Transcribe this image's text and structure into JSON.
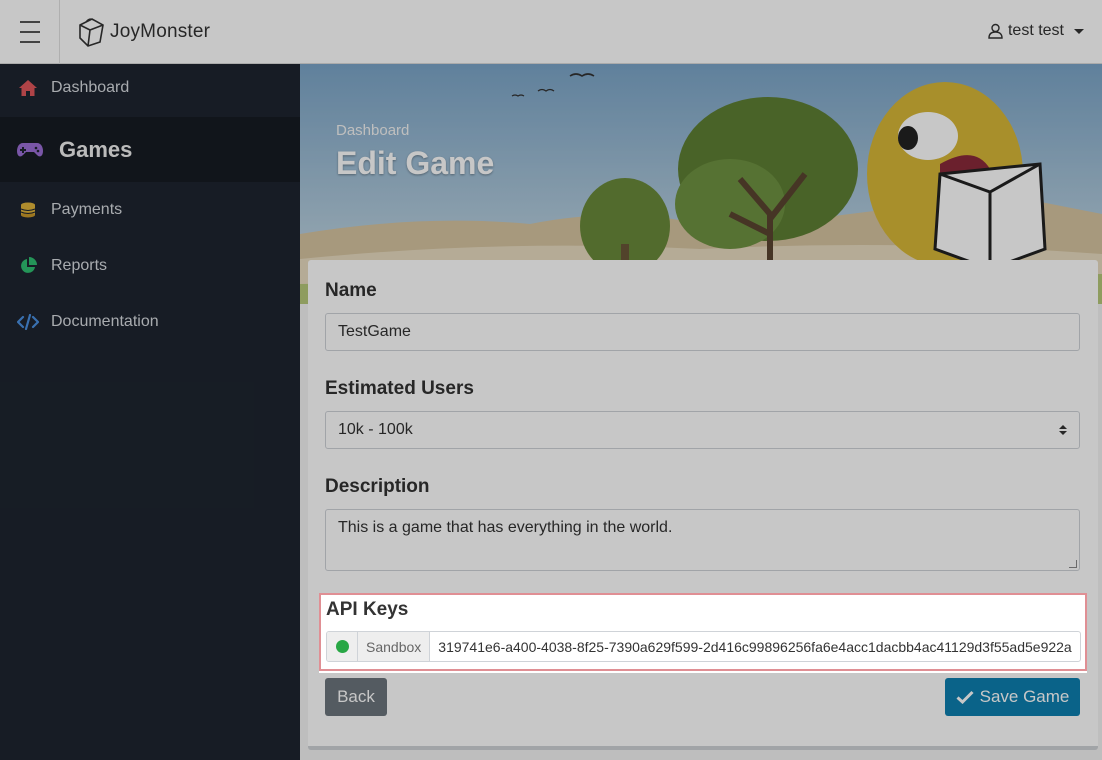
{
  "app": {
    "name": "JoyMonster"
  },
  "user": {
    "name": "test test"
  },
  "sidebar": {
    "items": [
      {
        "label": "Dashboard",
        "icon": "home-icon",
        "color": "#e0565b"
      },
      {
        "label": "Games",
        "icon": "gamepad-icon",
        "color": "#9b6fd6",
        "active": true
      },
      {
        "label": "Payments",
        "icon": "coins-icon",
        "color": "#e0b43a"
      },
      {
        "label": "Reports",
        "icon": "pie-chart-icon",
        "color": "#2fbf71"
      },
      {
        "label": "Documentation",
        "icon": "code-icon",
        "color": "#4a90e2"
      }
    ]
  },
  "header": {
    "breadcrumb": "Dashboard",
    "title": "Edit Game"
  },
  "form": {
    "name_label": "Name",
    "name_value": "TestGame",
    "users_label": "Estimated Users",
    "users_value": "10k - 100k",
    "description_label": "Description",
    "description_value": "This is a game that has everything in the world.",
    "api_label": "API Keys",
    "api_env": "Sandbox",
    "api_key": "319741e6-a400-4038-8f25-7390a629f599-2d416c99896256fa6e4acc1dacbb4ac41129d3f55ad5e922a",
    "back_label": "Back",
    "save_label": "Save Game"
  },
  "colors": {
    "accent": "#0d7fb0",
    "highlight": "#e08f94",
    "status_ok": "#28a745"
  }
}
